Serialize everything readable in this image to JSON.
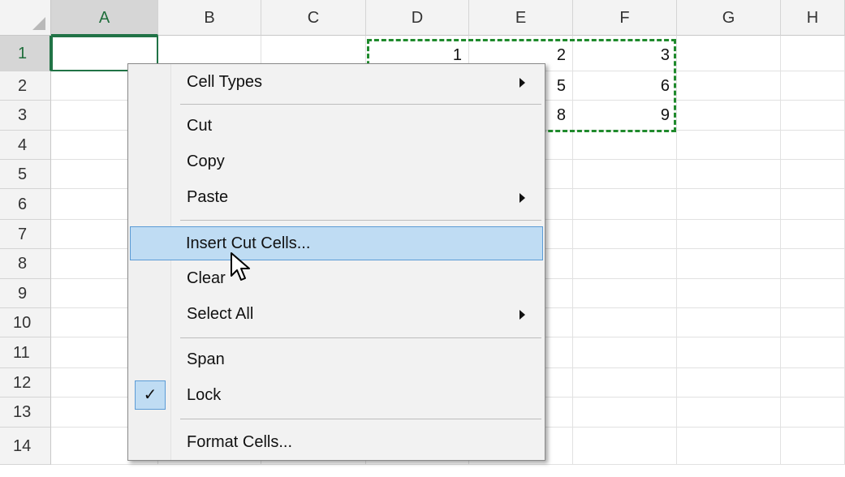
{
  "sheet": {
    "columns": [
      "A",
      "B",
      "C",
      "D",
      "E",
      "F",
      "G",
      "H"
    ],
    "rows": [
      "1",
      "2",
      "3",
      "4",
      "5",
      "6",
      "7",
      "8",
      "9",
      "10",
      "11",
      "12",
      "13",
      "14"
    ],
    "cells": {
      "D1": "1",
      "E1": "2",
      "F1": "3",
      "E2": "5",
      "F2": "6",
      "E3": "8",
      "F3": "9"
    },
    "active_cell": "A1",
    "cut_range": "D1:F3"
  },
  "context_menu": {
    "items": [
      {
        "label": "Cell Types",
        "submenu": true
      },
      {
        "label": "Cut"
      },
      {
        "label": "Copy"
      },
      {
        "label": "Paste",
        "submenu": true
      },
      {
        "label": "Insert Cut Cells...",
        "highlighted": true
      },
      {
        "label": "Clear"
      },
      {
        "label": "Select All",
        "submenu": true
      },
      {
        "label": "Span"
      },
      {
        "label": "Lock",
        "checked": true
      },
      {
        "label": "Format Cells..."
      }
    ]
  },
  "colors": {
    "accent_green": "#217346",
    "cut_border": "#1f8a2c",
    "highlight": "#bfdcf3"
  },
  "icons": {
    "check": "check-icon",
    "submenu_arrow": "submenu-arrow-icon",
    "cursor": "mouse-pointer-icon"
  }
}
